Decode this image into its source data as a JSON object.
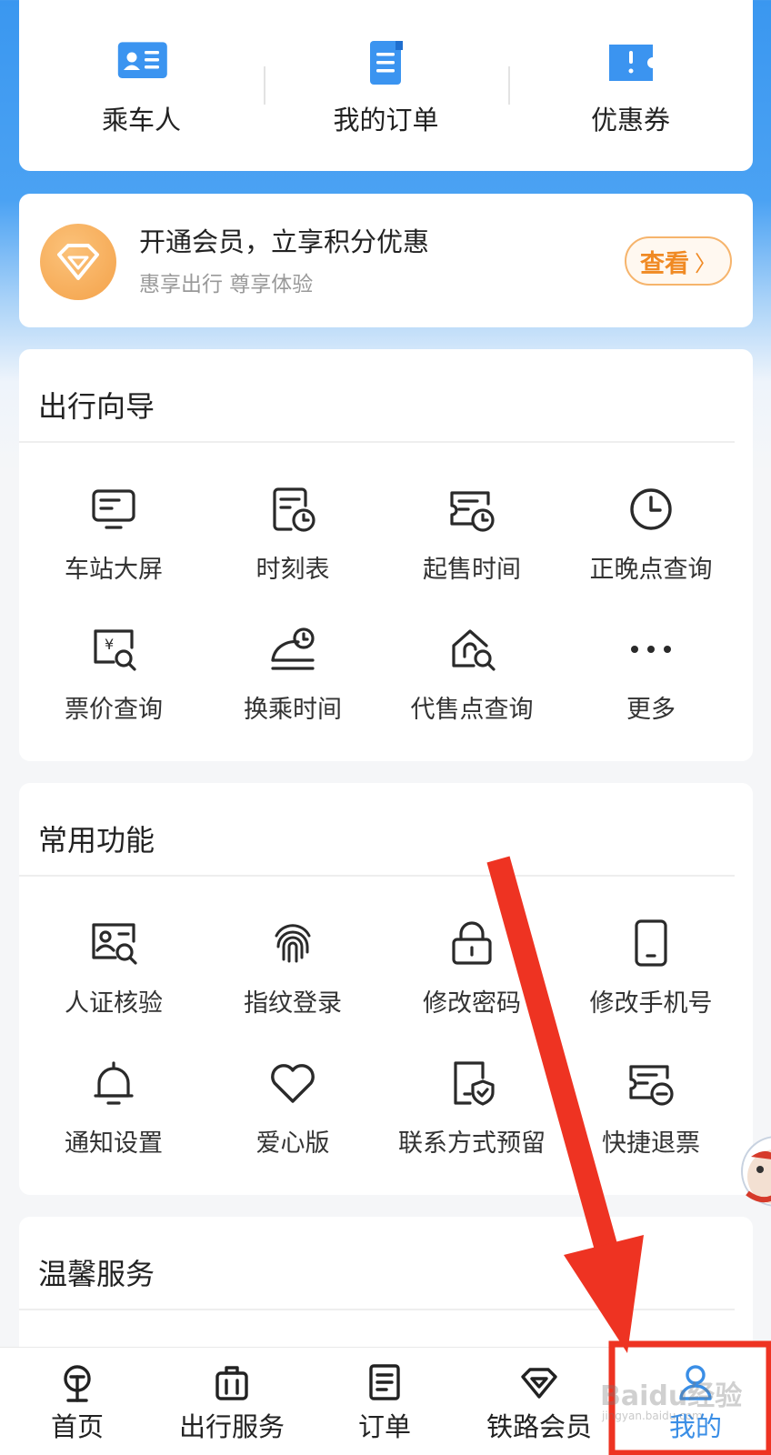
{
  "top_shortcuts": [
    {
      "label": "乘车人",
      "icon": "id-card-icon"
    },
    {
      "label": "我的订单",
      "icon": "order-document-icon"
    },
    {
      "label": "优惠券",
      "icon": "coupon-ticket-icon"
    }
  ],
  "member": {
    "title": "开通会员，立享积分优惠",
    "subtitle": "惠享出行 尊享体验",
    "button_label": "查看",
    "button_arrow": "〉",
    "icon": "diamond-gem-icon"
  },
  "travel_guide": {
    "title": "出行向导",
    "items": [
      {
        "label": "车站大屏",
        "icon": "station-screen-icon"
      },
      {
        "label": "时刻表",
        "icon": "timetable-icon"
      },
      {
        "label": "起售时间",
        "icon": "sale-time-icon"
      },
      {
        "label": "正晚点查询",
        "icon": "clock-icon"
      },
      {
        "label": "票价查询",
        "icon": "fare-search-icon"
      },
      {
        "label": "换乘时间",
        "icon": "transfer-time-icon"
      },
      {
        "label": "代售点查询",
        "icon": "agency-search-icon"
      },
      {
        "label": "更多",
        "icon": "more-dots-icon"
      }
    ]
  },
  "common_functions": {
    "title": "常用功能",
    "items": [
      {
        "label": "人证核验",
        "icon": "id-verify-icon"
      },
      {
        "label": "指纹登录",
        "icon": "fingerprint-icon"
      },
      {
        "label": "修改密码",
        "icon": "lock-icon"
      },
      {
        "label": "修改手机号",
        "icon": "phone-icon"
      },
      {
        "label": "通知设置",
        "icon": "bell-icon"
      },
      {
        "label": "爱心版",
        "icon": "heart-icon"
      },
      {
        "label": "联系方式预留",
        "icon": "contact-shield-icon"
      },
      {
        "label": "快捷退票",
        "icon": "refund-ticket-icon"
      }
    ]
  },
  "warm_service": {
    "title": "温馨服务"
  },
  "bottom_nav": [
    {
      "label": "首页",
      "icon": "railway-logo-icon"
    },
    {
      "label": "出行服务",
      "icon": "luggage-icon"
    },
    {
      "label": "订单",
      "icon": "order-icon"
    },
    {
      "label": "铁路会员",
      "icon": "diamond-icon"
    },
    {
      "label": "我的",
      "icon": "user-icon",
      "active": true
    }
  ],
  "watermark": {
    "text": "Baidu经验",
    "sub": "jingyan.baidu.com"
  },
  "colors": {
    "brand_blue": "#3a97f0",
    "active_tab": "#3a8ee6",
    "member_orange": "#f08a24",
    "annotation_red": "#ee3322"
  }
}
